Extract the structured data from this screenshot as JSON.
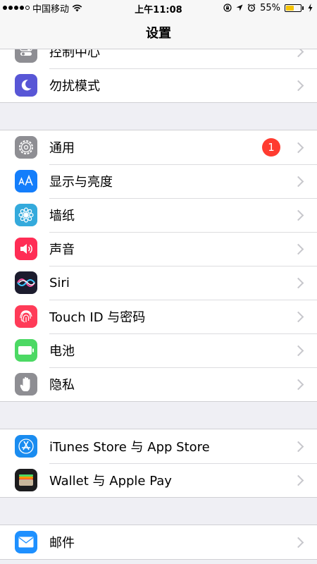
{
  "status_bar": {
    "carrier": "中国移动",
    "time": "上午11:08",
    "battery_percent": "55%",
    "battery_level": 0.55,
    "icons": [
      "signal-dots-icon",
      "wifi-icon",
      "lock-rotation-icon",
      "location-icon",
      "alarm-icon",
      "battery-icon",
      "charging-icon"
    ]
  },
  "nav": {
    "title": "设置"
  },
  "groups": [
    {
      "rows": [
        {
          "label": "控制中心",
          "icon": "control-center-icon",
          "color": "#8e8e93"
        },
        {
          "label": "勿扰模式",
          "icon": "moon-icon",
          "color": "#5856d6"
        }
      ]
    },
    {
      "rows": [
        {
          "label": "通用",
          "icon": "gear-icon",
          "color": "#8e8e93",
          "badge": "1"
        },
        {
          "label": "显示与亮度",
          "icon": "display-aa-icon",
          "color": "#147efb"
        },
        {
          "label": "墙纸",
          "icon": "wallpaper-flower-icon",
          "color": "#34aadc"
        },
        {
          "label": "声音",
          "icon": "speaker-icon",
          "color": "#ff2d55"
        },
        {
          "label": "Siri",
          "icon": "siri-icon",
          "color": "#1c1c2e"
        },
        {
          "label": "Touch ID 与密码",
          "icon": "fingerprint-icon",
          "color": "#ff3b58"
        },
        {
          "label": "电池",
          "icon": "battery-icon",
          "color": "#4cd964"
        },
        {
          "label": "隐私",
          "icon": "hand-icon",
          "color": "#8e8e93"
        }
      ]
    },
    {
      "rows": [
        {
          "label": "iTunes Store 与 App Store",
          "icon": "app-store-icon",
          "color": "#1a8cf0"
        },
        {
          "label": "Wallet 与 Apple Pay",
          "icon": "wallet-icon",
          "color": "#1c1c1e"
        }
      ]
    },
    {
      "rows": [
        {
          "label": "邮件",
          "icon": "mail-icon",
          "color": "#1e90ff"
        }
      ]
    }
  ]
}
